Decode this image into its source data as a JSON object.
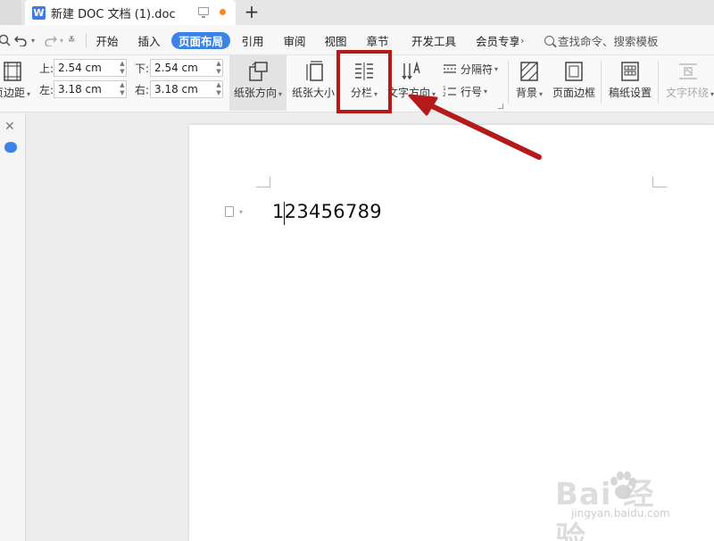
{
  "window": {
    "tab_title": "新建 DOC 文档 (1).doc",
    "add_tab": "+"
  },
  "menubar": {
    "items": [
      "开始",
      "插入",
      "页面布局",
      "引用",
      "审阅",
      "视图",
      "章节",
      "开发工具",
      "会员专享"
    ],
    "active": "页面布局",
    "more": "›",
    "search_text": "查找命令、搜索模板"
  },
  "ribbon": {
    "page_margin_label": "页边距",
    "top_label": "上:",
    "top_value": "2.54 cm",
    "bottom_label": "下:",
    "bottom_value": "2.54 cm",
    "left_label": "左:",
    "left_value": "3.18 cm",
    "right_label": "右:",
    "right_value": "3.18 cm",
    "orientation_label": "纸张方向",
    "paper_size_label": "纸张大小",
    "columns_label": "分栏",
    "text_direction_label": "文字方向",
    "separator_label": "分隔符",
    "line_number_label": "行号",
    "background_label": "背景",
    "page_border_label": "页面边框",
    "draft_paper_label": "稿纸设置",
    "text_wrap_label": "文字环绕"
  },
  "document": {
    "body_text": "123456789"
  },
  "watermark": {
    "title": "Bai  经验",
    "url": "jingyan.baidu.com"
  },
  "colors": {
    "accent": "#3c82e8",
    "highlight": "#b51a1a"
  }
}
